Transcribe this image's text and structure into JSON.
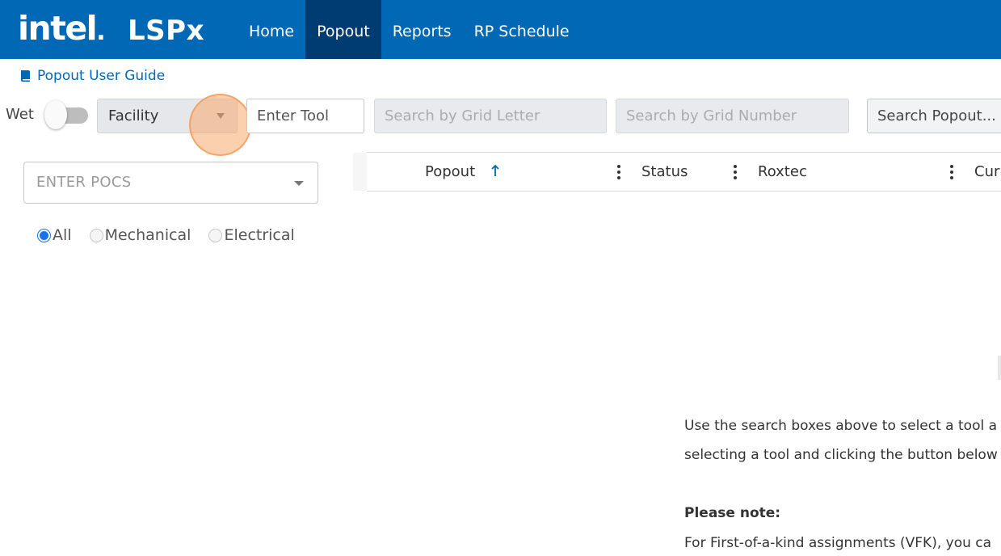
{
  "header": {
    "brand": "intel",
    "brand_dot": ".",
    "app_name": "LSPx",
    "nav": [
      {
        "label": "Home",
        "active": false
      },
      {
        "label": "Popout",
        "active": true
      },
      {
        "label": "Reports",
        "active": false
      },
      {
        "label": "RP Schedule",
        "active": false
      }
    ]
  },
  "guide_link": {
    "label": "Popout User Guide",
    "icon": "book-icon"
  },
  "toolbar": {
    "wet_label": "Wet",
    "wet_on": false,
    "facility_value": "Facility",
    "tool_placeholder": "Enter Tool",
    "grid_letter_placeholder": "Search by Grid Letter",
    "grid_number_placeholder": "Search by Grid Number",
    "popout_placeholder": "Search Popout..."
  },
  "left_panel": {
    "pocs_placeholder": "ENTER POCS",
    "radios": [
      {
        "label": "All",
        "checked": true
      },
      {
        "label": "Mechanical",
        "checked": false
      },
      {
        "label": "Electrical",
        "checked": false
      }
    ]
  },
  "grid": {
    "columns": [
      {
        "label": "Popout",
        "sorted": "asc"
      },
      {
        "label": "Status"
      },
      {
        "label": "Roxtec"
      },
      {
        "label": "Cur"
      }
    ]
  },
  "info": {
    "line1": "Use the search boxes above to select a tool a",
    "line2": "selecting a tool and clicking the button below",
    "note_title": "Please note:",
    "line3": "For First-of-a-kind assignments (VFK), you ca"
  },
  "colors": {
    "header_bg": "#0068b5",
    "nav_active_bg": "#003c71",
    "link": "#0068b5",
    "radio_accent": "#1a73e8"
  }
}
